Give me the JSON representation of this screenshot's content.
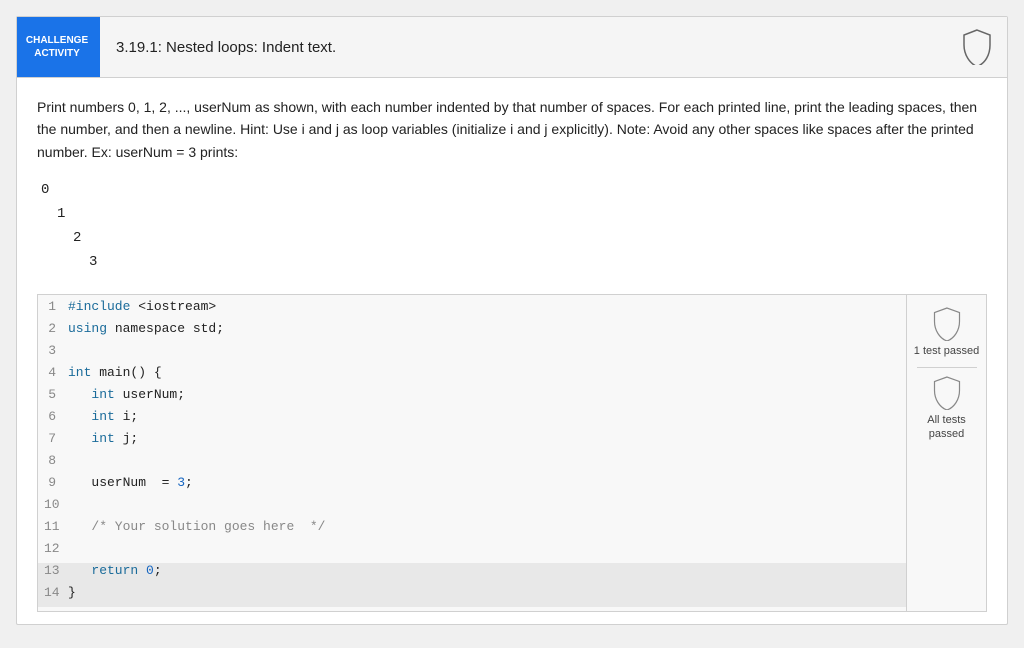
{
  "header": {
    "badge_text": "CHALLENGE\nACTIVITY",
    "title": "3.19.1: Nested loops: Indent text.",
    "shield_label": ""
  },
  "description": "Print numbers 0, 1, 2, ..., userNum as shown, with each number indented by that number of spaces. For each printed line, print the leading spaces, then the number, and then a newline. Hint: Use i and j as loop variables (initialize i and j explicitly). Note: Avoid any other spaces like spaces after the printed number. Ex: userNum = 3 prints:",
  "example_output": {
    "lines": [
      {
        "indent": 0,
        "text": "0"
      },
      {
        "indent": 1,
        "text": "1"
      },
      {
        "indent": 2,
        "text": "2"
      },
      {
        "indent": 3,
        "text": "3"
      }
    ]
  },
  "code": {
    "lines": [
      {
        "num": 1,
        "content": "#include <iostream>",
        "type": "include"
      },
      {
        "num": 2,
        "content": "using namespace std;",
        "type": "using"
      },
      {
        "num": 3,
        "content": "",
        "type": "normal"
      },
      {
        "num": 4,
        "content": "int main() {",
        "type": "normal"
      },
      {
        "num": 5,
        "content": "   int userNum;",
        "type": "normal"
      },
      {
        "num": 6,
        "content": "   int i;",
        "type": "normal"
      },
      {
        "num": 7,
        "content": "   int j;",
        "type": "normal"
      },
      {
        "num": 8,
        "content": "",
        "type": "normal"
      },
      {
        "num": 9,
        "content": "   userNum  = 3;",
        "type": "assignment"
      },
      {
        "num": 10,
        "content": "",
        "type": "normal"
      },
      {
        "num": 11,
        "content": "   /* Your solution goes here  */",
        "type": "comment"
      },
      {
        "num": 12,
        "content": "",
        "type": "normal"
      },
      {
        "num": 13,
        "content": "   return 0;",
        "type": "return"
      },
      {
        "num": 14,
        "content": "}",
        "type": "normal"
      }
    ]
  },
  "side_panel": {
    "test1_label": "1 test\npassed",
    "test2_label": "All tests\npassed"
  }
}
